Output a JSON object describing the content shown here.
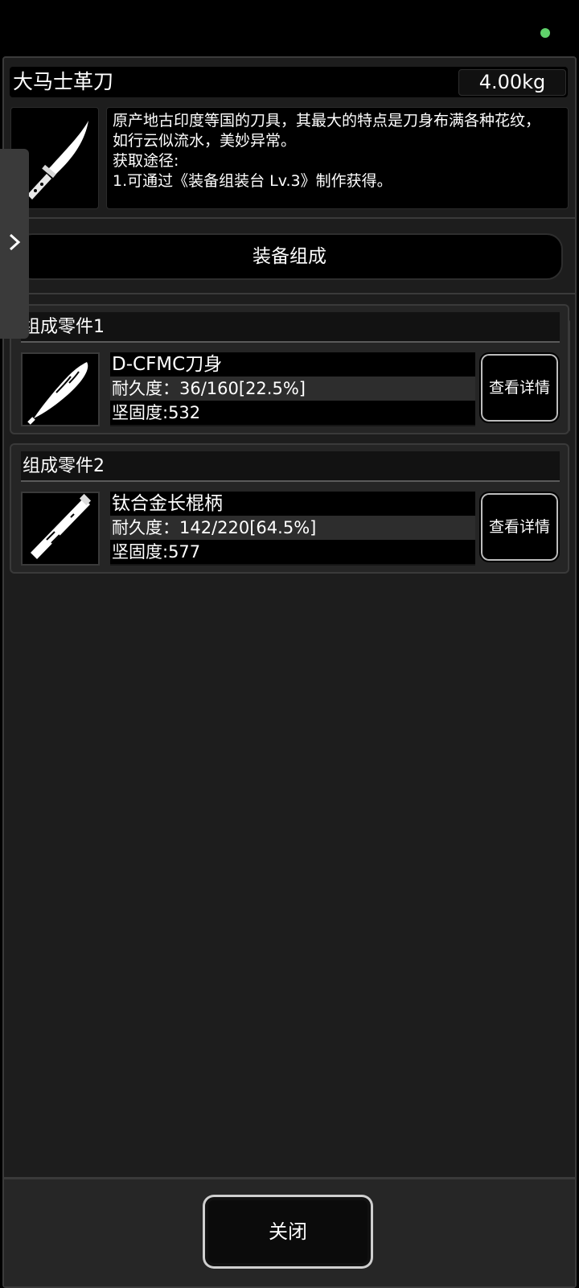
{
  "item": {
    "title": "大马士革刀",
    "weight": "4.00kg",
    "description_lines": [
      "原产地古印度等国的刀具，其最大的特点是刀身布满各种花纹，",
      "如行云似流水，美妙异常。",
      "获取途径:",
      "1.可通过《装备组装台 Lv.3》制作获得。"
    ]
  },
  "side_tab": {
    "icon": "chevron-right-icon"
  },
  "section": {
    "header": "装备组成"
  },
  "parts": [
    {
      "label": "组成零件1",
      "name": "D-CFMC刀身",
      "durability": "耐久度：36/160[22.5%]",
      "firmness": "坚固度:532",
      "detail_button": "查看详情",
      "icon": "curved-blade-icon"
    },
    {
      "label": "组成零件2",
      "name": "钛合金长棍柄",
      "durability": "耐久度：142/220[64.5%]",
      "firmness": "坚固度:577",
      "detail_button": "查看详情",
      "icon": "long-handle-icon"
    }
  ],
  "footer": {
    "close_label": "关闭"
  },
  "colors": {
    "status_dot": "#5fd16a",
    "panel_bg": "#1d1d1d",
    "card_bg": "#252525"
  }
}
